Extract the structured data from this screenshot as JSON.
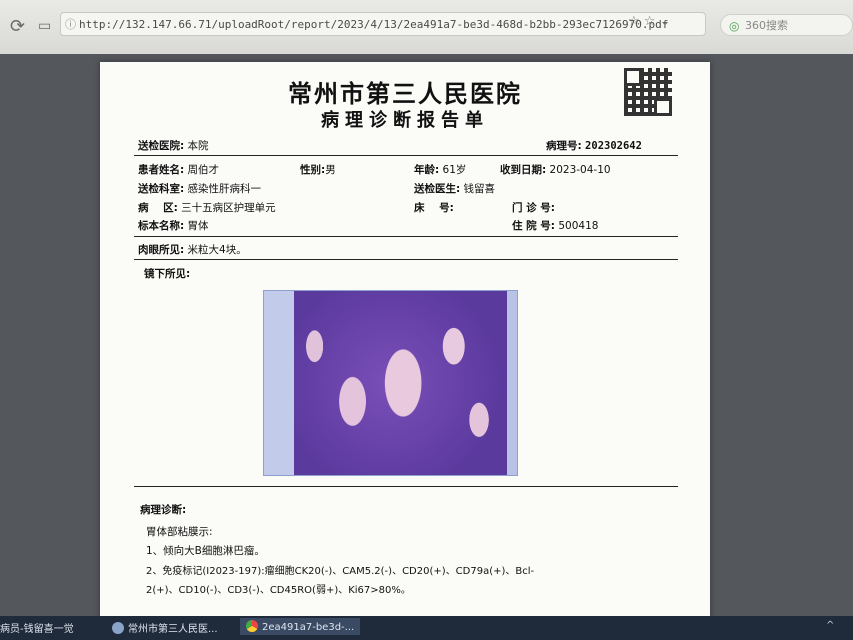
{
  "browser": {
    "url": "http://132.147.66.71/uploadRoot/report/2023/4/13/2ea491a7-be3d-468d-b2bb-293ec7126970.pdf",
    "search_placeholder": "360搜索"
  },
  "report": {
    "hospital": "常州市第三人民医院",
    "title": "病理诊断报告单",
    "sending_hospital_label": "送检医院:",
    "sending_hospital": "本院",
    "pathology_no_label": "病理号:",
    "pathology_no": "202302642",
    "patient_name_label": "患者姓名:",
    "patient_name": "周伯才",
    "gender_label": "性别:",
    "gender": "男",
    "age_label": "年龄:",
    "age": "61岁",
    "received_label": "收到日期:",
    "received": "2023-04-10",
    "dept_label": "送检科室:",
    "dept": "感染性肝病科一",
    "doctor_label": "送检医生:",
    "doctor": "钱留喜",
    "ward_label": "病    区:",
    "ward": "三十五病区护理单元",
    "bed_label": "床    号:",
    "bed": "",
    "clinic_label": "门 诊 号:",
    "clinic": "",
    "specimen_label": "标本名称:",
    "specimen": "胃体",
    "inpatient_label": "住 院 号:",
    "inpatient": "500418",
    "gross_label": "肉眼所见:",
    "gross": "米粒大4块。",
    "micro_label": "镜下所见:",
    "diagnosis_label": "病理诊断:",
    "diag_line1": "胃体部粘膜示:",
    "diag_line2": "1、倾向大B细胞淋巴瘤。",
    "diag_line3": "2、免疫标记(I2023-197):瘤细胞CK20(-)、CAM5.2(-)、CD20(+)、CD79a(+)、Bcl-",
    "diag_line4": "2(+)、CD10(-)、CD3(-)、CD45RO(弱+)、Ki67>80%。"
  },
  "taskbar": {
    "item1": "病员-钱留喜一觉",
    "item2": "常州市第三人民医...",
    "item3": "2ea491a7-be3d-..."
  }
}
